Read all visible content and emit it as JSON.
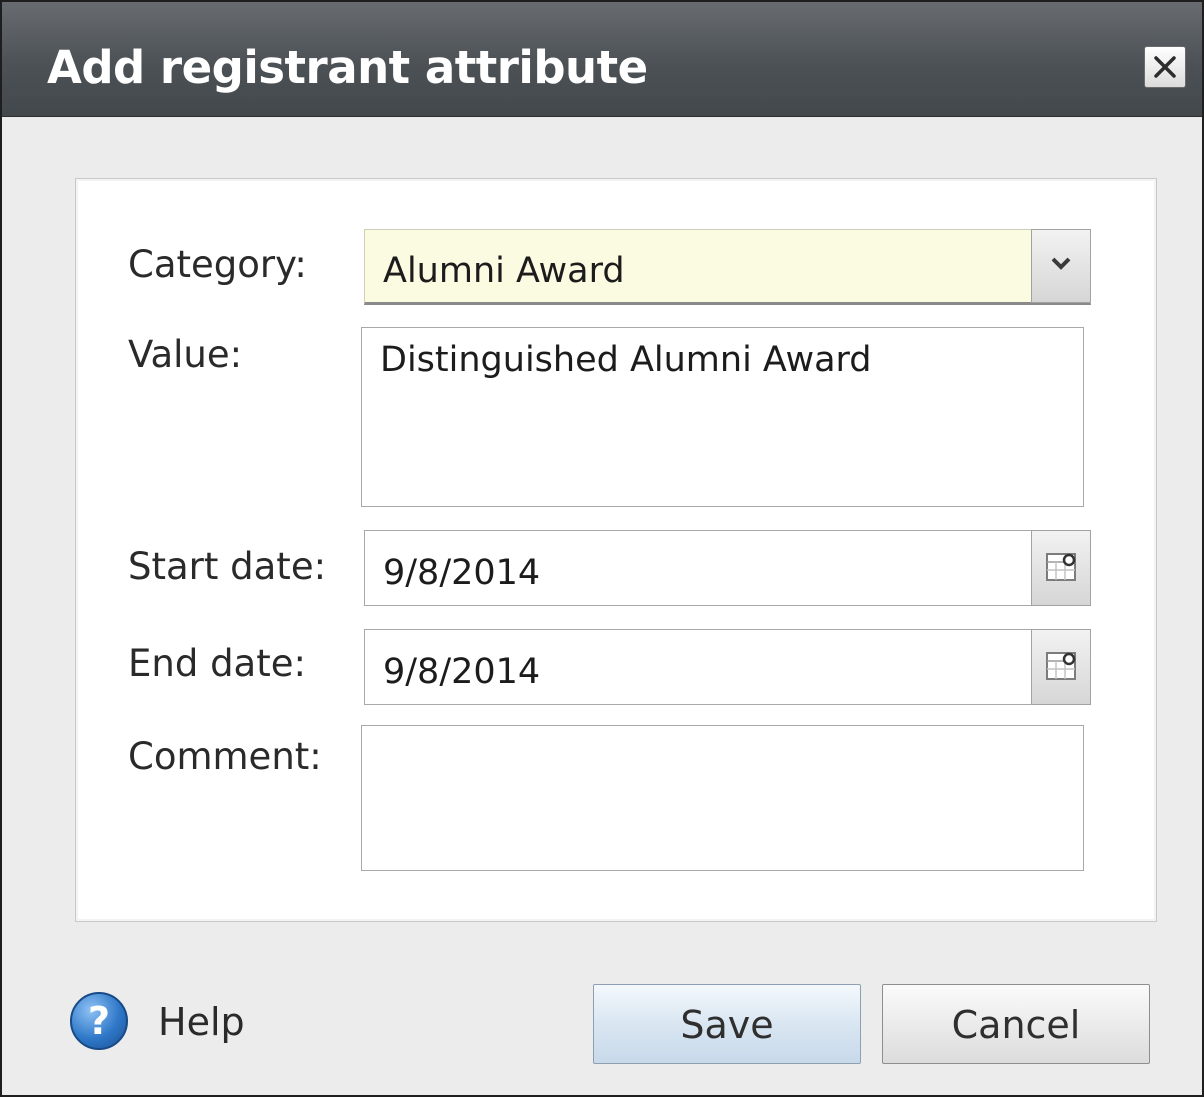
{
  "dialog": {
    "title": "Add registrant attribute",
    "close_icon": "close-icon"
  },
  "form": {
    "category": {
      "label": "Category:",
      "value": "Alumni Award",
      "icon": "chevron-down-icon"
    },
    "value": {
      "label": "Value:",
      "value": "Distinguished Alumni Award"
    },
    "start_date": {
      "label": "Start date:",
      "value": "9/8/2014",
      "icon": "calendar-icon"
    },
    "end_date": {
      "label": "End date:",
      "value": "9/8/2014",
      "icon": "calendar-icon"
    },
    "comment": {
      "label": "Comment:",
      "value": ""
    }
  },
  "footer": {
    "help_icon": "help-icon",
    "help_label": "Help",
    "save_label": "Save",
    "cancel_label": "Cancel"
  },
  "colors": {
    "titlebar": "#4c5155",
    "select_background": "#fbfbe1",
    "save_button": "#d9e6f2"
  }
}
